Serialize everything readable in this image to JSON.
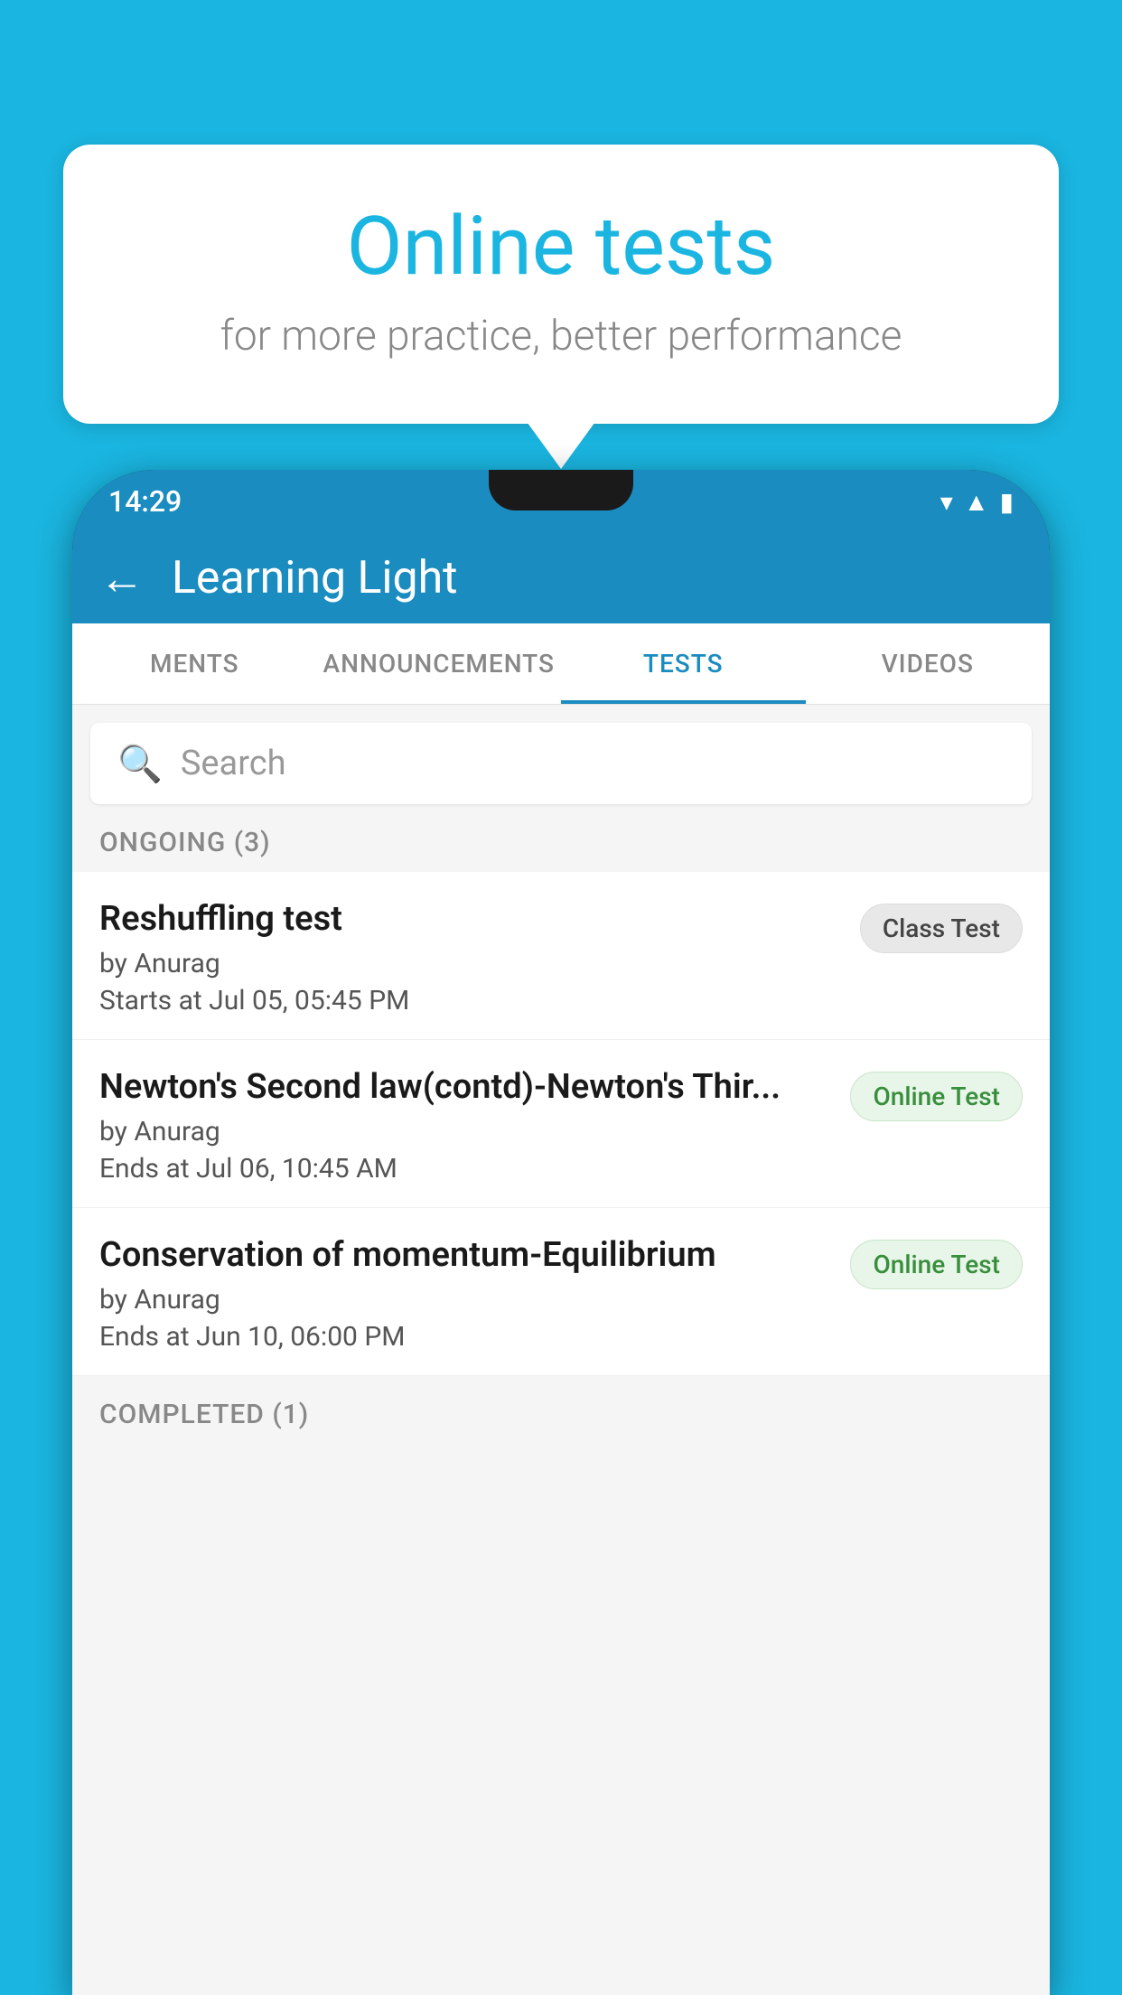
{
  "background_color": "#1ab5e0",
  "bubble": {
    "title": "Online tests",
    "subtitle": "for more practice, better performance"
  },
  "phone": {
    "status_bar": {
      "time": "14:29",
      "icons": [
        "wifi",
        "signal",
        "battery"
      ]
    },
    "app_bar": {
      "title": "Learning Light",
      "back_label": "←"
    },
    "tabs": [
      {
        "label": "MENTS",
        "active": false
      },
      {
        "label": "ANNOUNCEMENTS",
        "active": false
      },
      {
        "label": "TESTS",
        "active": true
      },
      {
        "label": "VIDEOS",
        "active": false
      }
    ],
    "search": {
      "placeholder": "Search"
    },
    "ongoing_section": {
      "header": "ONGOING (3)",
      "items": [
        {
          "title": "Reshuffling test",
          "author": "by Anurag",
          "date": "Starts at  Jul 05, 05:45 PM",
          "badge": "Class Test",
          "badge_type": "class"
        },
        {
          "title": "Newton's Second law(contd)-Newton's Thir...",
          "author": "by Anurag",
          "date": "Ends at  Jul 06, 10:45 AM",
          "badge": "Online Test",
          "badge_type": "online"
        },
        {
          "title": "Conservation of momentum-Equilibrium",
          "author": "by Anurag",
          "date": "Ends at  Jun 10, 06:00 PM",
          "badge": "Online Test",
          "badge_type": "online"
        }
      ]
    },
    "completed_section": {
      "header": "COMPLETED (1)"
    }
  }
}
